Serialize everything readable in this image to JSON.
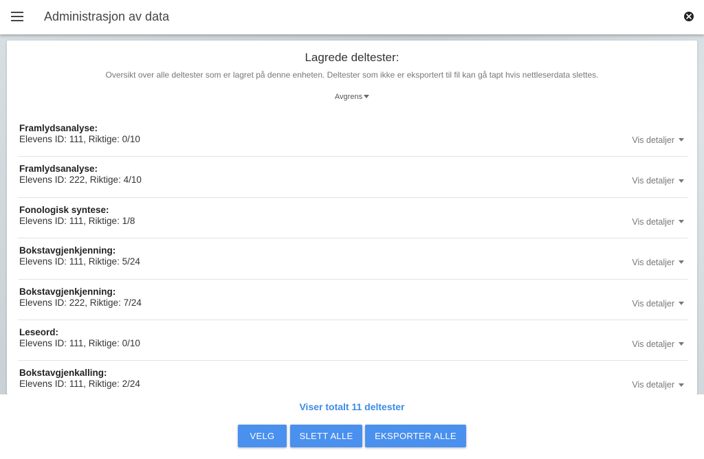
{
  "appbar": {
    "title": "Administrasjon av data",
    "menu_icon": "menu-icon",
    "close_icon": "close-icon"
  },
  "card": {
    "title": "Lagrede deltester:",
    "description": "Oversikt over alle deltester som er lagret på denne enheten. Deltester som ikke er eksportert til fil kan gå tapt hvis nettleserdata slettes.",
    "filter_label": "Avgrens"
  },
  "tests": [
    {
      "name": "Framlydsanalyse:",
      "info": "Elevens ID: 111, Riktige: 0/10",
      "details": "Vis detaljer"
    },
    {
      "name": "Framlydsanalyse:",
      "info": "Elevens ID: 222, Riktige: 4/10",
      "details": "Vis detaljer"
    },
    {
      "name": "Fonologisk syntese:",
      "info": "Elevens ID: 111, Riktige: 1/8",
      "details": "Vis detaljer"
    },
    {
      "name": "Bokstavgjenkjenning:",
      "info": "Elevens ID: 111, Riktige: 5/24",
      "details": "Vis detaljer"
    },
    {
      "name": "Bokstavgjenkjenning:",
      "info": "Elevens ID: 222, Riktige: 7/24",
      "details": "Vis detaljer"
    },
    {
      "name": "Leseord:",
      "info": "Elevens ID: 111, Riktige: 0/10",
      "details": "Vis detaljer"
    },
    {
      "name": "Bokstavgjenkalling:",
      "info": "Elevens ID: 111, Riktige: 2/24",
      "details": "Vis detaljer"
    }
  ],
  "footer": {
    "total_text": "Viser totalt 11 deltester",
    "buttons": {
      "select": "VELG",
      "delete_all": "SLETT ALLE",
      "export_all": "EKSPORTER ALLE"
    }
  },
  "colors": {
    "accent": "#4a90ee",
    "total_text": "#3b8be8",
    "appbar_bg": "#ffffff"
  }
}
